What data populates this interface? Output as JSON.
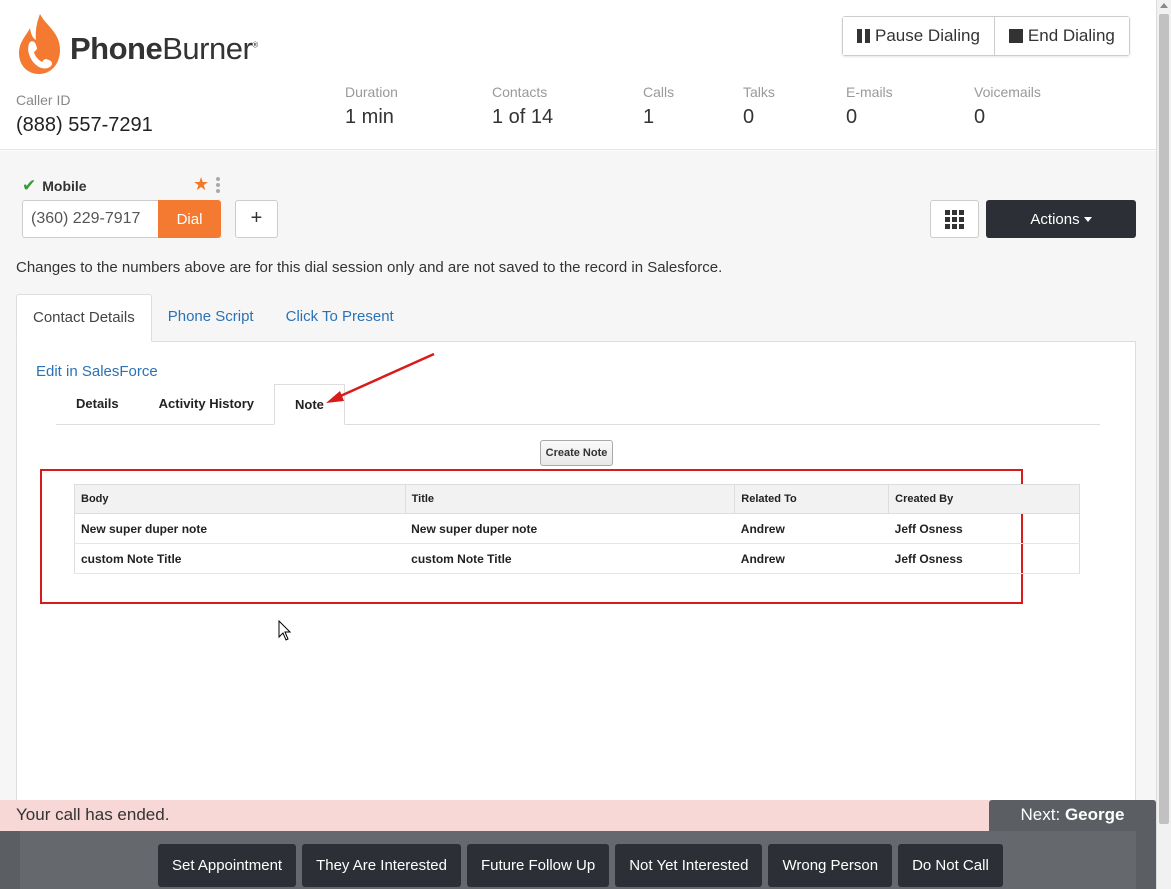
{
  "app": {
    "logo_bold": "Phone",
    "logo_light": "Burner",
    "logo_mark": "®"
  },
  "caller_id": {
    "label": "Caller ID",
    "value": "(888) 557-7291"
  },
  "stats": [
    {
      "label": "Duration",
      "value": "1 min"
    },
    {
      "label": "Contacts",
      "value": "1 of 14"
    },
    {
      "label": "Calls",
      "value": "1"
    },
    {
      "label": "Talks",
      "value": "0"
    },
    {
      "label": "E-mails",
      "value": "0"
    },
    {
      "label": "Voicemails",
      "value": "0"
    }
  ],
  "top_buttons": {
    "pause": "Pause Dialing",
    "end": "End Dialing"
  },
  "phone": {
    "type_label": "Mobile",
    "number": "(360) 229-7917",
    "dial_label": "Dial",
    "add_label": "+"
  },
  "actions_label": "Actions",
  "notice": "Changes to the numbers above are for this dial session only and are not saved to the record in Salesforce.",
  "tabs": [
    {
      "label": "Contact Details"
    },
    {
      "label": "Phone Script"
    },
    {
      "label": "Click To Present"
    }
  ],
  "edit_link": "Edit in SalesForce",
  "subtabs": [
    {
      "label": "Details"
    },
    {
      "label": "Activity History"
    },
    {
      "label": "Note"
    }
  ],
  "create_note_label": "Create Note",
  "notes_table": {
    "headers": [
      "Body",
      "Title",
      "Related To",
      "Created By"
    ],
    "rows": [
      [
        "New super duper note",
        "New super duper note",
        "Andrew",
        "Jeff Osness"
      ],
      [
        "custom Note Title",
        "custom Note Title",
        "Andrew",
        "Jeff Osness"
      ]
    ]
  },
  "status": {
    "message": "Your call has ended.",
    "next_prefix": "Next:",
    "next_name": "George"
  },
  "dispositions": [
    {
      "label": "Set Appointment"
    },
    {
      "label": "They Are Interested"
    },
    {
      "label": "Future Follow Up"
    },
    {
      "label": "Not Yet Interested"
    },
    {
      "label": "Wrong Person"
    },
    {
      "label": "Do Not Call"
    }
  ],
  "colors": {
    "brand_orange": "#f47a32",
    "link_blue": "#2a72b5",
    "dark_button": "#2c2f36",
    "highlight_red": "#d81c1c"
  }
}
